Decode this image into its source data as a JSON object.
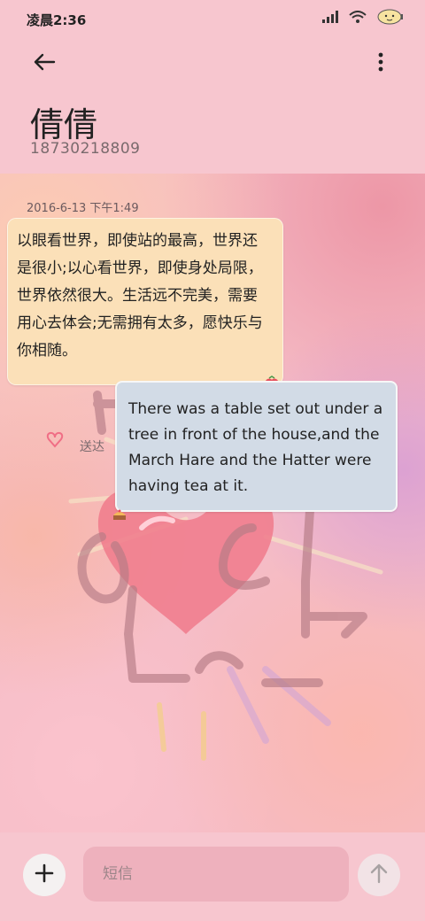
{
  "status_bar": {
    "time": "凌晨2:36",
    "icons": [
      "signal-icon",
      "wifi-icon",
      "battery-icon"
    ]
  },
  "header": {
    "back_icon": "arrow-left-icon",
    "more_icon": "more-vertical-icon",
    "contact_name": "倩倩",
    "contact_number": "18730218809"
  },
  "conversation": {
    "timestamp": "2016-6-13 下午1:49",
    "messages": [
      {
        "direction": "incoming",
        "text": "以眼看世界，即使站的最高，世界还是很小;以心看世界，即使身处局限，世界依然很大。生活远不完美，需要用心去体会;无需拥有太多，愿快乐与你相随。"
      },
      {
        "direction": "outgoing",
        "text": "There was a table set out under a tree in front of the house,and the March Hare and the Hatter were having tea at it.",
        "status": "送达"
      }
    ]
  },
  "composer": {
    "placeholder": "短信",
    "add_icon": "plus-icon",
    "send_icon": "arrow-up-icon"
  },
  "colors": {
    "background": "#f7c6cf",
    "incoming_bubble": "#fbe0b8",
    "outgoing_bubble": "#d2dbe6"
  }
}
